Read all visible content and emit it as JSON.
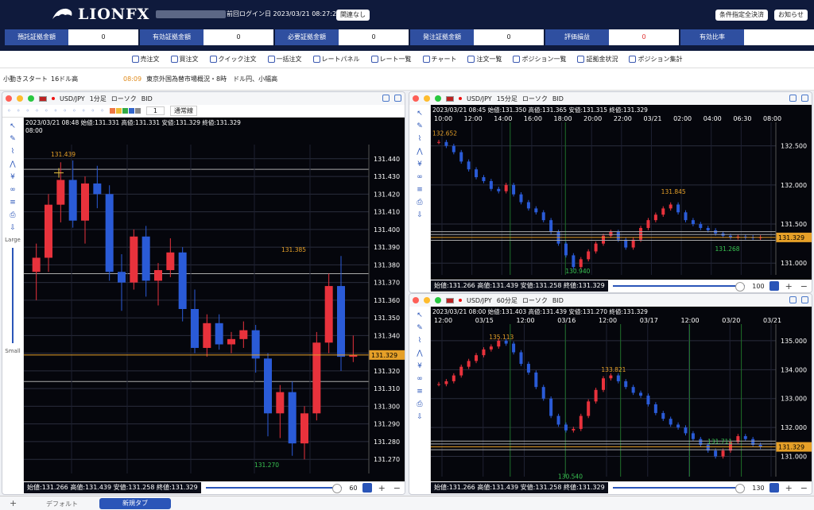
{
  "app": {
    "brand": "LIONFX",
    "login_label": "前回ログイン日",
    "login_time": "2023/03/21 08:27:28",
    "btn_unrelated": "関連なし",
    "btn_settle": "条件指定全決済",
    "btn_notice": "お知らせ"
  },
  "stats": [
    {
      "label": "預託証拠金額",
      "value": "0",
      "color": "#222222"
    },
    {
      "label": "有効証拠金額",
      "value": "0",
      "color": "#222222"
    },
    {
      "label": "必要証拠金額",
      "value": "0",
      "color": "#222222"
    },
    {
      "label": "発注証拠金額",
      "value": "0",
      "color": "#222222"
    },
    {
      "label": "評価損益",
      "value": "0",
      "color": "#e03030"
    },
    {
      "label": "有効比率",
      "value": "",
      "color": "#222222"
    }
  ],
  "menu": [
    {
      "label": "売注文",
      "icon": "sell-order-icon"
    },
    {
      "label": "買注文",
      "icon": "buy-order-icon"
    },
    {
      "label": "クイック注文",
      "icon": "quick-order-icon"
    },
    {
      "label": "一括注文",
      "icon": "bulk-order-icon"
    },
    {
      "label": "レートパネル",
      "icon": "rate-panel-icon"
    },
    {
      "label": "レート一覧",
      "icon": "rate-list-icon"
    },
    {
      "label": "チャート",
      "icon": "chart-icon"
    },
    {
      "label": "注文一覧",
      "icon": "order-list-icon"
    },
    {
      "label": "ポジション一覧",
      "icon": "position-list-icon"
    },
    {
      "label": "証拠金状況",
      "icon": "margin-status-icon"
    },
    {
      "label": "ポジション集計",
      "icon": "position-summary-icon"
    }
  ],
  "news": {
    "left_a": "小動きスタート",
    "left_b": "16ドル高",
    "time": "08:09",
    "headline": "東京外国為替市場概況・8時　ドル円、小幅高"
  },
  "tabs": {
    "default": "デフォルト",
    "new": "新規タブ"
  },
  "charts": [
    {
      "pair": "USD/JPY",
      "timeframe": "1分足",
      "chart_type": "ローソク",
      "side": "BID",
      "line_type": "通常線",
      "count_input": "1",
      "info": "2023/03/21 08:48  始値:131.331  高値:131.331  安値:131.329  終値:131.329",
      "time_label": "08:00",
      "yaxis": [
        "131.440",
        "131.430",
        "131.420",
        "131.410",
        "131.400",
        "131.390",
        "131.380",
        "131.370",
        "131.360",
        "131.350",
        "131.340",
        "131.330",
        "131.320",
        "131.310",
        "131.300",
        "131.290",
        "131.280",
        "131.270"
      ],
      "current": "131.329",
      "ann_high": "131.439",
      "ann_high2": "131.385",
      "ann_low": "131.270",
      "foot": "始値:131.266  高値:131.439  安値:131.258  終値:131.329",
      "zoom": "60",
      "large": "Large",
      "small": "Small",
      "ymin": 131.262,
      "ymax": 131.448,
      "candles": [
        [
          131.376,
          131.392,
          131.36,
          131.384
        ],
        [
          131.384,
          131.42,
          131.376,
          131.414
        ],
        [
          131.414,
          131.438,
          131.404,
          131.428
        ],
        [
          131.428,
          131.439,
          131.401,
          131.405
        ],
        [
          131.405,
          131.43,
          131.392,
          131.426
        ],
        [
          131.426,
          131.436,
          131.412,
          131.42
        ],
        [
          131.42,
          131.425,
          131.371,
          131.376
        ],
        [
          131.376,
          131.386,
          131.354,
          131.37
        ],
        [
          131.37,
          131.4,
          131.366,
          131.396
        ],
        [
          131.396,
          131.402,
          131.362,
          131.371
        ],
        [
          131.371,
          131.381,
          131.357,
          131.377
        ],
        [
          131.377,
          131.395,
          131.373,
          131.387
        ],
        [
          131.387,
          131.39,
          131.348,
          131.355
        ],
        [
          131.355,
          131.366,
          131.33,
          131.333
        ],
        [
          131.333,
          131.352,
          131.328,
          131.347
        ],
        [
          131.347,
          131.352,
          131.332,
          131.335
        ],
        [
          131.335,
          131.342,
          131.33,
          131.338
        ],
        [
          131.338,
          131.348,
          131.333,
          131.343
        ],
        [
          131.343,
          131.346,
          131.319,
          131.327
        ],
        [
          131.327,
          131.33,
          131.283,
          131.296
        ],
        [
          131.296,
          131.312,
          131.282,
          131.308
        ],
        [
          131.308,
          131.314,
          131.272,
          131.279
        ],
        [
          131.279,
          131.3,
          131.27,
          131.296
        ],
        [
          131.296,
          131.342,
          131.292,
          131.336
        ],
        [
          131.336,
          131.375,
          131.33,
          131.368
        ],
        [
          131.368,
          131.385,
          131.32,
          131.328
        ],
        [
          131.328,
          131.34,
          131.325,
          131.329
        ]
      ]
    },
    {
      "pair": "USD/JPY",
      "timeframe": "15分足",
      "chart_type": "ローソク",
      "side": "BID",
      "info": "2023/03/21 08:45  始値:131.350  高値:131.365  安値:131.315  終値:131.329",
      "xaxis": [
        "10:00",
        "12:00",
        "14:00",
        "16:00",
        "18:00",
        "20:00",
        "22:00",
        "03/21",
        "02:00",
        "04:00",
        "06:30",
        "08:00"
      ],
      "yaxis": [
        "132.500",
        "132.000",
        "131.500",
        "131.000"
      ],
      "current": "131.329",
      "ann_high": "132.652",
      "ann_mid": "131.845",
      "ann_low": "130.940",
      "ann_low2": "131.268",
      "foot": "始値:131.266  高値:131.439  安値:131.258  終値:131.329",
      "zoom": "100",
      "ymin": 130.85,
      "ymax": 132.7,
      "closes": [
        132.55,
        132.5,
        132.42,
        132.3,
        132.2,
        132.1,
        132.05,
        131.95,
        131.92,
        132.0,
        131.88,
        131.78,
        131.7,
        131.65,
        131.55,
        131.4,
        131.25,
        131.1,
        130.95,
        131.05,
        131.15,
        131.25,
        131.35,
        131.4,
        131.3,
        131.2,
        131.3,
        131.45,
        131.55,
        131.62,
        131.7,
        131.75,
        131.65,
        131.55,
        131.5,
        131.45,
        131.42,
        131.38,
        131.35,
        131.33,
        131.34,
        131.33,
        131.32,
        131.33
      ]
    },
    {
      "pair": "USD/JPY",
      "timeframe": "60分足",
      "chart_type": "ローソク",
      "side": "BID",
      "info": "2023/03/21 08:00  始値:131.403  高値:131.439  安値:131.270  終値:131.329",
      "xaxis": [
        "12:00",
        "03/15",
        "12:00",
        "03/16",
        "12:00",
        "03/17",
        "12:00",
        "03/20",
        "03/21"
      ],
      "yaxis": [
        "135.000",
        "134.000",
        "133.000",
        "132.000",
        "131.329",
        "131.000"
      ],
      "current": "131.329",
      "ann_high": "135.113",
      "ann_mid": "133.821",
      "ann_low": "131.711",
      "ann_low2": "130.540",
      "foot": "始値:131.266  高値:131.439  安値:131.258  終値:131.329",
      "zoom": "130",
      "ymin": 130.3,
      "ymax": 135.3,
      "closes": [
        133.5,
        133.6,
        133.8,
        134.1,
        134.3,
        134.5,
        134.7,
        134.8,
        135.0,
        134.9,
        134.6,
        134.2,
        133.9,
        133.4,
        133.0,
        132.4,
        132.1,
        131.9,
        131.95,
        132.4,
        132.9,
        133.3,
        133.7,
        133.8,
        133.6,
        133.4,
        133.2,
        133.1,
        132.8,
        132.5,
        132.3,
        132.1,
        132.0,
        131.8,
        131.6,
        131.4,
        131.2,
        131.0,
        131.2,
        131.5,
        131.7,
        131.6,
        131.4,
        131.33
      ]
    }
  ]
}
